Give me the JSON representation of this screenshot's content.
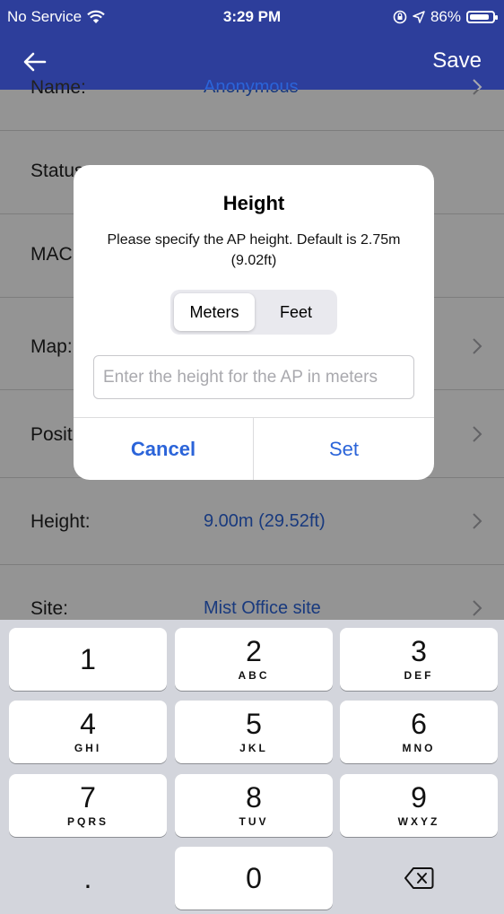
{
  "status_bar": {
    "carrier": "No Service",
    "time": "3:29 PM",
    "battery": "86%",
    "battery_level": 0.86,
    "icons": [
      "wifi-icon",
      "lock-rotation-icon",
      "location-icon",
      "battery-icon"
    ]
  },
  "nav": {
    "back_icon": "back-arrow-icon",
    "save_label": "Save"
  },
  "rows": [
    {
      "label": "Name:",
      "value": "Anonymous",
      "chevron": true
    },
    {
      "label": "Status:",
      "value": "",
      "chevron": false
    },
    {
      "label": "MAC:",
      "value": "",
      "chevron": false
    },
    {
      "label": "Map:",
      "value": "",
      "chevron": true
    },
    {
      "label": "Position:",
      "value": "",
      "chevron": true
    },
    {
      "label": "Height:",
      "value": "9.00m (29.52ft)",
      "chevron": true
    },
    {
      "label": "Site:",
      "value": "Mist Office site",
      "chevron": true
    }
  ],
  "dialog": {
    "title": "Height",
    "message": "Please specify the AP height. Default is 2.75m (9.02ft)",
    "segments": [
      "Meters",
      "Feet"
    ],
    "selected_segment": "Meters",
    "input_value": "",
    "input_placeholder": "Enter the height for the AP in meters",
    "cancel_label": "Cancel",
    "set_label": "Set"
  },
  "keyboard": {
    "keys": [
      {
        "digit": "1",
        "letters": ""
      },
      {
        "digit": "2",
        "letters": "ABC"
      },
      {
        "digit": "3",
        "letters": "DEF"
      },
      {
        "digit": "4",
        "letters": "GHI"
      },
      {
        "digit": "5",
        "letters": "JKL"
      },
      {
        "digit": "6",
        "letters": "MNO"
      },
      {
        "digit": "7",
        "letters": "PQRS"
      },
      {
        "digit": "8",
        "letters": "TUV"
      },
      {
        "digit": "9",
        "letters": "WXYZ"
      },
      {
        "digit": "0",
        "letters": ""
      }
    ],
    "decimal_label": ".",
    "delete_icon": "backspace-icon"
  },
  "colors": {
    "nav_background": "#2d3e9b",
    "accent": "#2b64d9",
    "keyboard_background": "#d3d5dc"
  }
}
